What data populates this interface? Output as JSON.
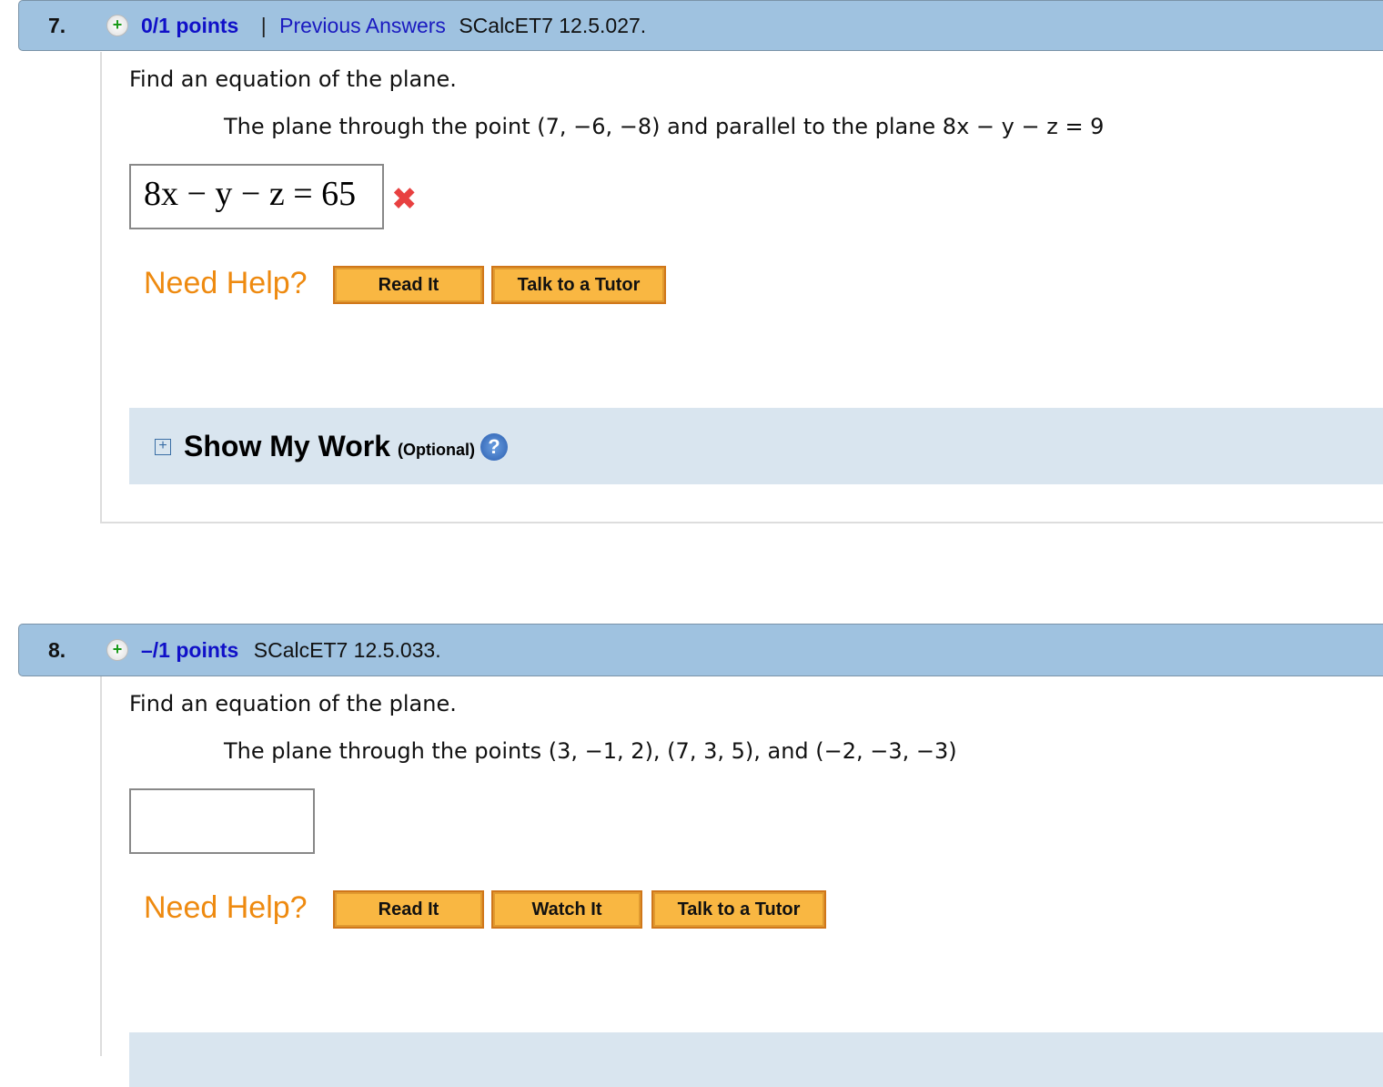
{
  "questions": [
    {
      "number": "7.",
      "points": "0/1 points",
      "separator": "|",
      "previous_answers": "Previous Answers",
      "code": "SCalcET7 12.5.027.",
      "prompt": "Find an equation of the plane.",
      "detail": "The plane through the point  (7, −6, −8)  and parallel to the plane 8x − y − z = 9",
      "answer": "8x − y − z = 65",
      "status": "incorrect",
      "status_glyph": "✖",
      "need_help": "Need Help?",
      "buttons": [
        "Read It",
        "Talk to a Tutor"
      ],
      "show_my_work": "Show My Work",
      "optional": "(Optional)",
      "help_glyph": "?"
    },
    {
      "number": "8.",
      "points": "–/1 points",
      "code": "SCalcET7 12.5.033.",
      "prompt": "Find an equation of the plane.",
      "detail": "The plane through the points  (3, −1, 2), (7, 3, 5), and (−2, −3, −3)",
      "answer": "",
      "need_help": "Need Help?",
      "buttons": [
        "Read It",
        "Watch It",
        "Talk to a Tutor"
      ]
    }
  ],
  "colors": {
    "header": "#9fc2e0",
    "points": "#1010c8",
    "need_help": "#ee8a10",
    "button": "#f9b742",
    "incorrect": "#e84040",
    "show_my_work_bg": "#d9e5ef"
  }
}
